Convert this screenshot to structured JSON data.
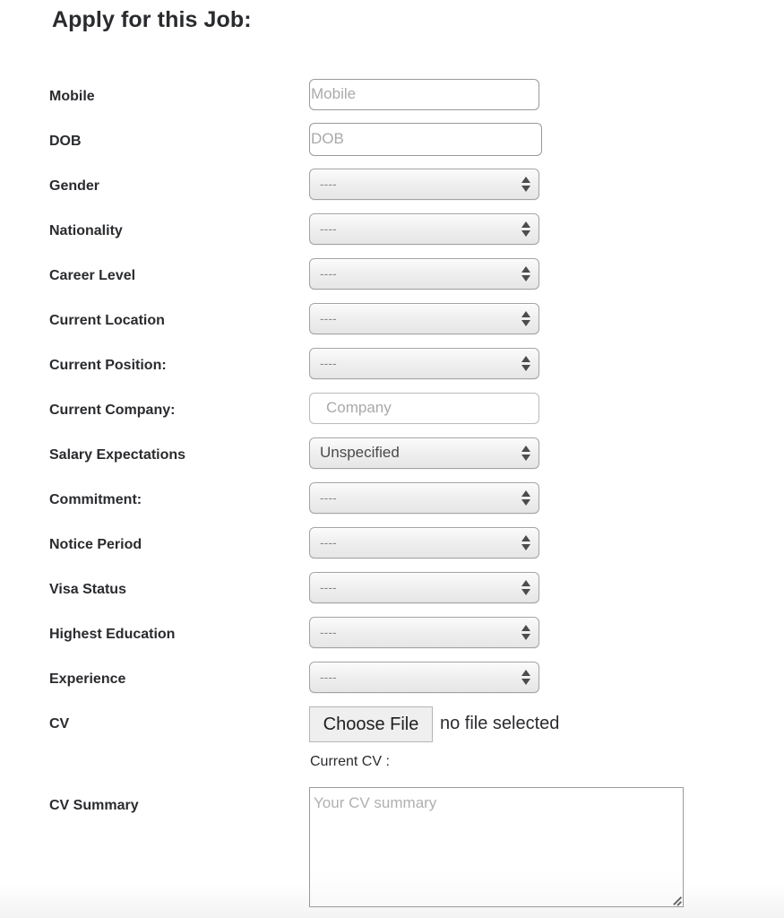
{
  "page": {
    "title": "Apply for this Job:"
  },
  "form": {
    "mobile": {
      "label": "Mobile",
      "placeholder": "Mobile",
      "value": ""
    },
    "dob": {
      "label": "DOB",
      "placeholder": "DOB",
      "value": ""
    },
    "gender": {
      "label": "Gender",
      "selected": "----"
    },
    "nationality": {
      "label": "Nationality",
      "selected": "----"
    },
    "career_level": {
      "label": "Career Level",
      "selected": "----"
    },
    "current_location": {
      "label": "Current Location",
      "selected": "----"
    },
    "current_position": {
      "label": "Current Position:",
      "selected": "----"
    },
    "current_company": {
      "label": "Current Company:",
      "placeholder": "Company",
      "value": ""
    },
    "salary_expectations": {
      "label": "Salary Expectations",
      "selected": "Unspecified"
    },
    "commitment": {
      "label": "Commitment:",
      "selected": "----"
    },
    "notice_period": {
      "label": "Notice Period",
      "selected": "----"
    },
    "visa_status": {
      "label": "Visa Status",
      "selected": "----"
    },
    "highest_education": {
      "label": "Highest Education",
      "selected": "----"
    },
    "experience": {
      "label": "Experience",
      "selected": "----"
    },
    "cv": {
      "label": "CV",
      "button_label": "Choose File",
      "status": "no file selected",
      "current_cv_label": "Current CV :"
    },
    "cv_summary": {
      "label": "CV Summary",
      "placeholder": "Your CV summary",
      "value": ""
    }
  },
  "icons": {
    "select_arrows": "up-down-arrows-icon",
    "textarea_resize": "resize-grip-icon"
  }
}
